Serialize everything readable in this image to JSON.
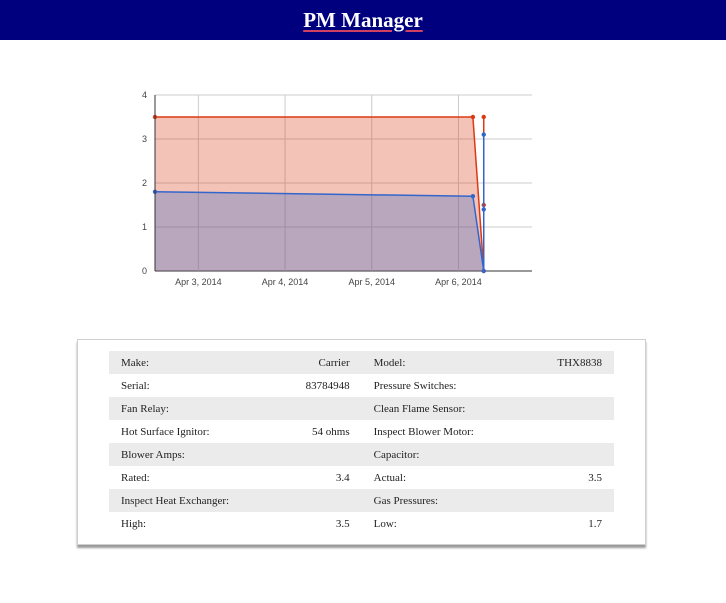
{
  "header": {
    "title": "PM Manager"
  },
  "colors": {
    "header_bg": "#00007f",
    "series_a": "#dc3912",
    "series_b": "#3366cc"
  },
  "chart_data": {
    "type": "area",
    "title": "",
    "xlabel": "",
    "ylabel": "",
    "ylim": [
      0,
      4
    ],
    "yticks": [
      0,
      1,
      2,
      3,
      4
    ],
    "x_ticks": [
      "Apr 3, 2014",
      "Apr 4, 2014",
      "Apr 5, 2014",
      "Apr 6, 2014"
    ],
    "grid": true,
    "legend": "none",
    "x": [
      "2014-04-02 12:00",
      "2014-04-06 04:00",
      "2014-04-06 07:00",
      "2014-04-06 07:00",
      "2014-04-06 07:00"
    ],
    "series": [
      {
        "color": "#dc3912",
        "values": [
          3.5,
          3.5,
          0,
          1.5,
          3.5
        ]
      },
      {
        "color": "#3366cc",
        "values": [
          1.8,
          1.7,
          0,
          1.4,
          3.1
        ]
      }
    ]
  },
  "details": {
    "rows": [
      {
        "shade": true,
        "l_label": "Make:",
        "l_value": "Carrier",
        "r_label": "Model:",
        "r_value": "THX8838"
      },
      {
        "shade": false,
        "l_label": "Serial:",
        "l_value": "83784948",
        "r_label": "Pressure Switches:",
        "r_value": ""
      },
      {
        "shade": true,
        "l_label": "Fan Relay:",
        "l_value": "",
        "r_label": "Clean Flame Sensor:",
        "r_value": ""
      },
      {
        "shade": false,
        "l_label": "Hot Surface Ignitor:",
        "l_value": "54 ohms",
        "r_label": "Inspect Blower Motor:",
        "r_value": ""
      },
      {
        "shade": true,
        "l_label": "Blower Amps:",
        "l_value": "",
        "r_label": "Capacitor:",
        "r_value": ""
      },
      {
        "shade": false,
        "l_label": "Rated:",
        "l_value": "3.4",
        "r_label": "Actual:",
        "r_value": "3.5"
      },
      {
        "shade": true,
        "l_label": "Inspect Heat Exchanger:",
        "l_value": "",
        "r_label": "Gas Pressures:",
        "r_value": ""
      },
      {
        "shade": false,
        "l_label": "High:",
        "l_value": "3.5",
        "r_label": "Low:",
        "r_value": "1.7"
      }
    ]
  }
}
